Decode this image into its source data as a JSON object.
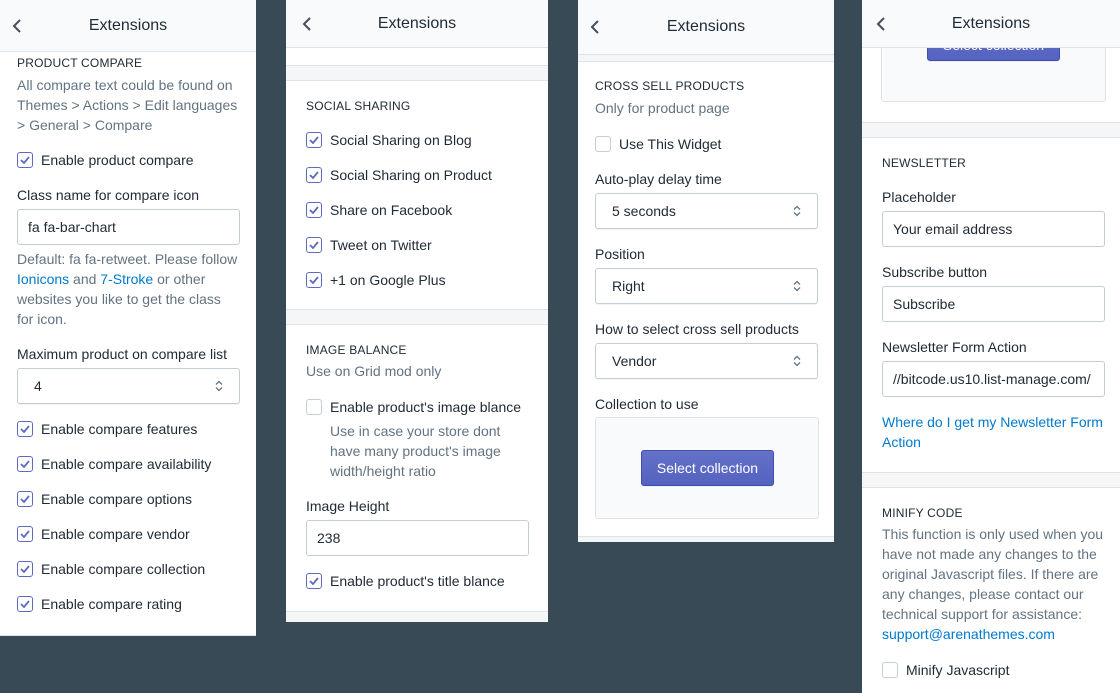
{
  "colors": {
    "background": "#374a56",
    "accent": "#5c6ac4",
    "link": "#007ace"
  },
  "panel1": {
    "title": "Extensions",
    "section_title": "PRODUCT COMPARE",
    "desc_lines": [
      "All compare text could be found on",
      "Themes > Actions > Edit languages",
      "> General > Compare"
    ],
    "enable_compare": {
      "label": "Enable product compare",
      "checked": true
    },
    "class_label": "Class name for compare icon",
    "class_value": "fa fa-bar-chart",
    "help_line1": "Default: fa fa-retweet. Please follow",
    "help_link1": "Ionicons",
    "help_and": " and ",
    "help_link2": "7-Stroke",
    "help_or": " or other",
    "help_line3": "websites you like to get the class",
    "help_line4": "for icon.",
    "max_label": "Maximum product on compare list",
    "max_value": "4",
    "options": [
      {
        "label": "Enable compare features",
        "checked": true
      },
      {
        "label": "Enable compare availability",
        "checked": true
      },
      {
        "label": "Enable compare options",
        "checked": true
      },
      {
        "label": "Enable compare vendor",
        "checked": true
      },
      {
        "label": "Enable compare collection",
        "checked": true
      },
      {
        "label": "Enable compare rating",
        "checked": true
      }
    ]
  },
  "panel2": {
    "title": "Extensions",
    "social_title": "SOCIAL SHARING",
    "social": [
      {
        "label": "Social Sharing on Blog",
        "checked": true
      },
      {
        "label": "Social Sharing on Product",
        "checked": true
      },
      {
        "label": "Share on Facebook",
        "checked": true
      },
      {
        "label": "Tweet on Twitter",
        "checked": true
      },
      {
        "label": "+1 on Google Plus",
        "checked": true
      }
    ],
    "balance_title": "IMAGE BALANCE",
    "balance_sub": "Use on Grid mod only",
    "image_blance": {
      "label": "Enable product's image blance",
      "checked": false
    },
    "blance_help": [
      "Use in case your store dont",
      "have many product's image",
      "width/height ratio"
    ],
    "height_label": "Image Height",
    "height_value": "238",
    "title_blance": {
      "label": "Enable product's title blance",
      "checked": true
    }
  },
  "panel3": {
    "title": "Extensions",
    "section_title": "CROSS SELL PRODUCTS",
    "section_sub": "Only for product page",
    "use_widget": {
      "label": "Use This Widget",
      "checked": false
    },
    "delay_label": "Auto-play delay time",
    "delay_value": "5 seconds",
    "position_label": "Position",
    "position_value": "Right",
    "how_label": "How to select cross sell products",
    "how_value": "Vendor",
    "collection_label": "Collection to use",
    "collection_button": "Select collection"
  },
  "panel4": {
    "title": "Extensions",
    "select_collection": "Select collection",
    "newsletter_title": "NEWSLETTER",
    "placeholder_label": "Placeholder",
    "placeholder_value": "Your email address",
    "subscribe_label": "Subscribe button",
    "subscribe_value": "Subscribe",
    "action_label": "Newsletter Form Action",
    "action_value": "//bitcode.us10.list-manage.com/",
    "where_link_1": "Where do I get my Newsletter Form",
    "where_link_2": "Action",
    "minify_title": "MINIFY CODE",
    "minify_desc": [
      "This function is only used when you",
      "have not made any changes to the",
      "original Javascript files. If there are",
      "any changes, please contact our",
      "technical support for assistance:"
    ],
    "support_email": "support@arenathemes.com",
    "minify_js": {
      "label": "Minify Javascript",
      "checked": false
    }
  }
}
